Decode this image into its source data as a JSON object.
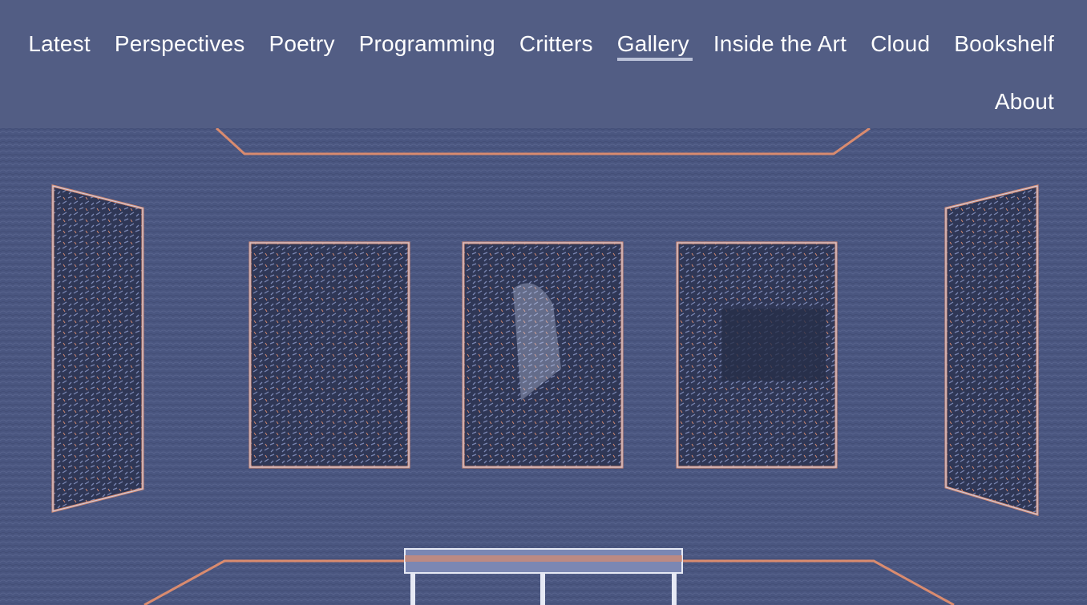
{
  "nav": {
    "items": [
      {
        "label": "Latest",
        "active": false
      },
      {
        "label": "Perspectives",
        "active": false
      },
      {
        "label": "Poetry",
        "active": false
      },
      {
        "label": "Programming",
        "active": false
      },
      {
        "label": "Critters",
        "active": false
      },
      {
        "label": "Gallery",
        "active": true
      },
      {
        "label": "Inside the Art",
        "active": false
      },
      {
        "label": "Cloud",
        "active": false
      },
      {
        "label": "Bookshelf",
        "active": false
      },
      {
        "label": "About",
        "active": false
      }
    ]
  },
  "colors": {
    "header_bg": "#525d84",
    "hero_bg": "#4a5680",
    "frame_accent": "#d98b6f",
    "active_underline": "#b9c0d7"
  }
}
